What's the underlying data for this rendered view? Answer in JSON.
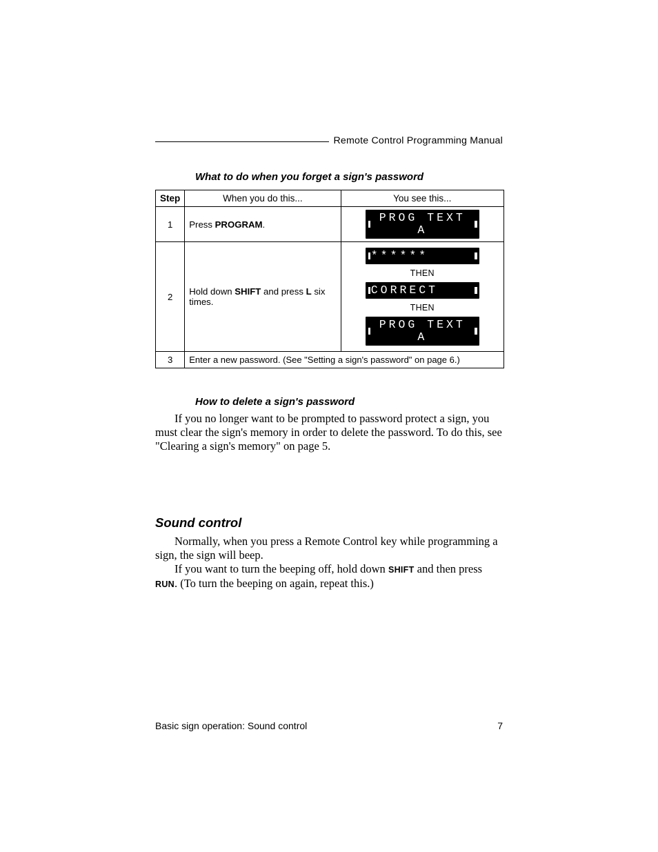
{
  "header": {
    "title": "Remote Control Programming Manual"
  },
  "section1": {
    "title": "What to do when you forget a sign's password",
    "columns": {
      "step": "Step",
      "do": "When you do this...",
      "see": "You see this..."
    },
    "row1": {
      "step": "1",
      "do_pre": "Press ",
      "do_bold": "PROGRAM",
      "do_post": ".",
      "lcd": "PROG TEXT A"
    },
    "row2": {
      "step": "2",
      "do_pre": "Hold down ",
      "do_b1": "SHIFT",
      "do_mid": " and press ",
      "do_b2": "L",
      "do_post": " six times.",
      "lcd_a": "******",
      "then1": "THEN",
      "lcd_b": "CORRECT",
      "then2": "THEN",
      "lcd_c": "PROG TEXT A"
    },
    "row3": {
      "step": "3",
      "text": "Enter a new password. (See \"Setting a sign's password\" on page 6.)"
    }
  },
  "section2": {
    "title": "How to delete a sign's password",
    "para": "If you no longer want to be prompted to password protect a sign, you must clear the sign's memory in order to delete the password. To do this, see \"Clearing a sign's memory\" on page 5."
  },
  "section3": {
    "title": "Sound control",
    "p1": "Normally, when you press a Remote Control key while programming a sign, the sign will beep.",
    "p2_pre": "If you want to turn the beeping off, hold down ",
    "p2_b1": "SHIFT",
    "p2_mid": " and then press ",
    "p2_b2": "RUN",
    "p2_post": ". (To turn the beeping on again, repeat this.)"
  },
  "footer": {
    "left": "Basic sign operation: Sound control",
    "page": "7"
  }
}
